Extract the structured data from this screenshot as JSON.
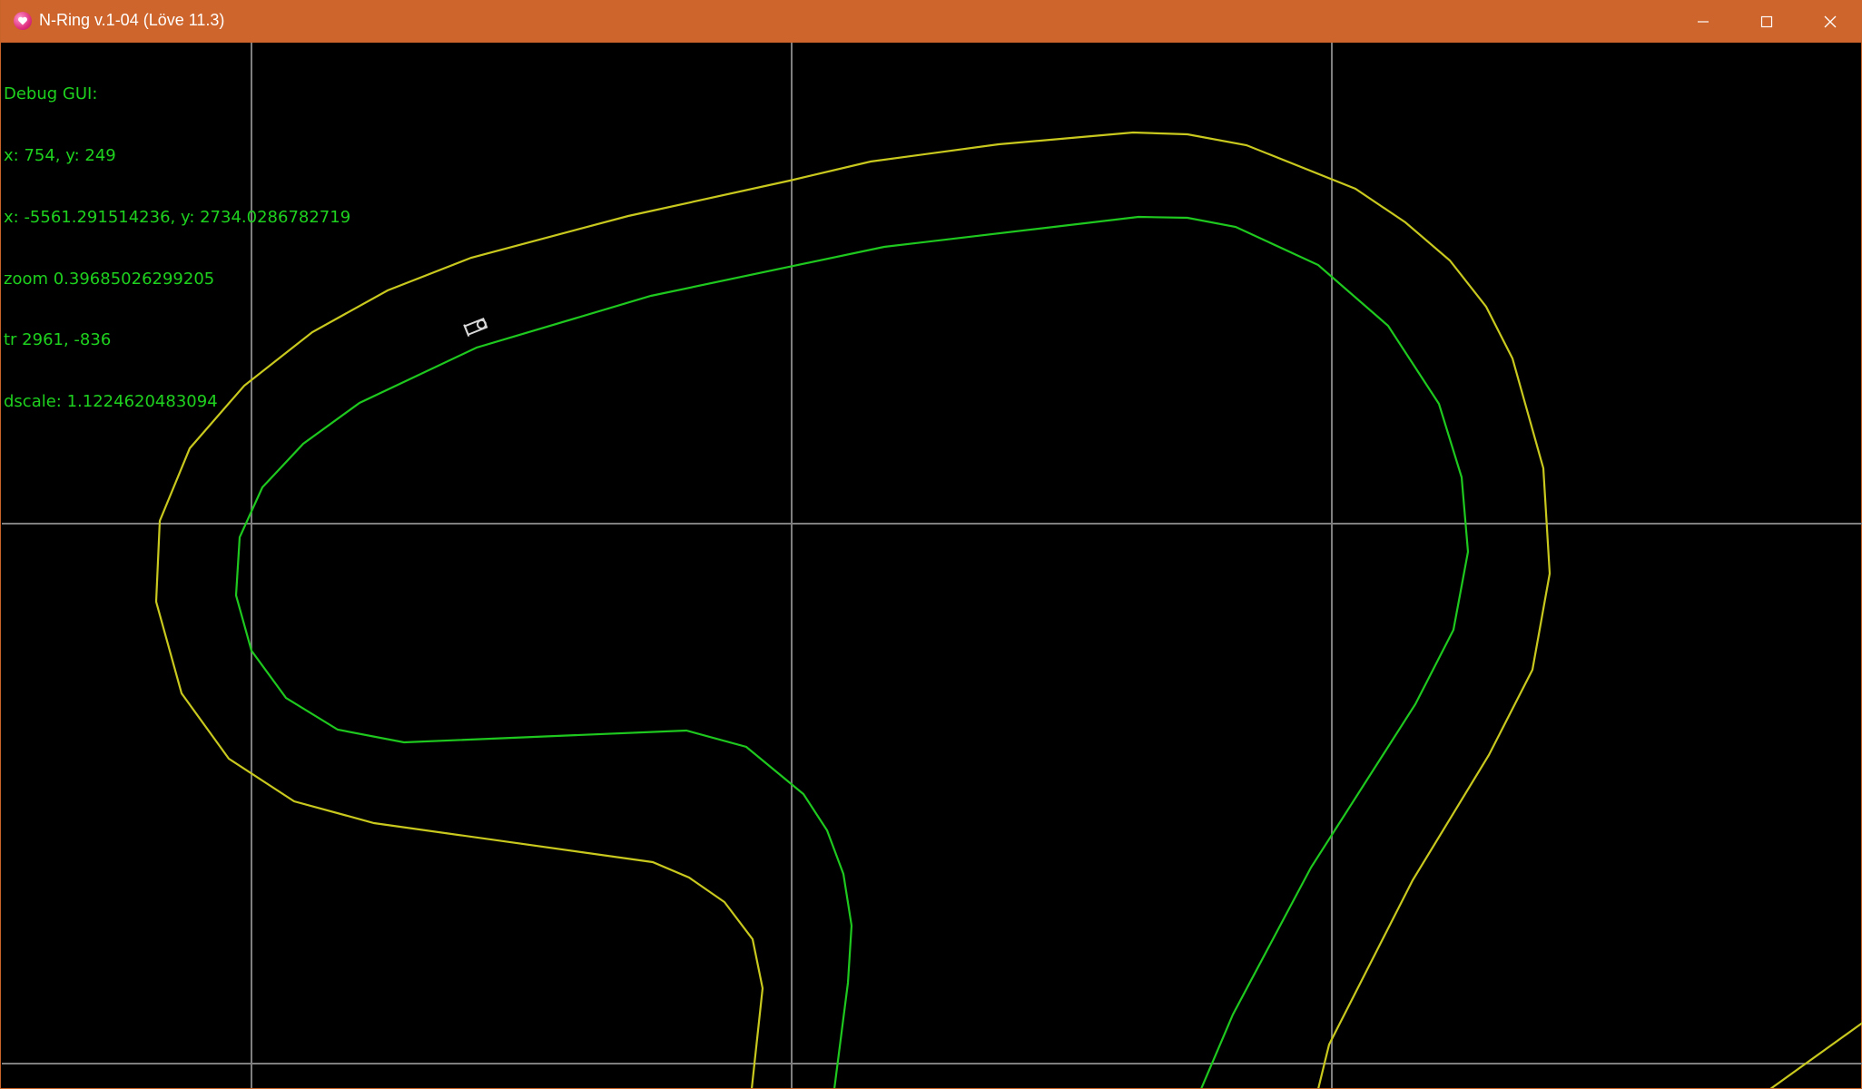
{
  "window": {
    "title": "N-Ring v.1-04 (Löve 11.3)",
    "icon": "love-heart-icon",
    "title_bar_color": "#cd652c",
    "controls": [
      "minimize-icon",
      "maximize-icon",
      "close-icon"
    ]
  },
  "debug": {
    "header": "Debug GUI:",
    "mouse": "x: 754, y: 249",
    "world": "x: -5561.291514236, y: 2734.0286782719",
    "zoom": "zoom 0.39685026299205",
    "translate": "tr 2961, -836",
    "dscale": "dscale: 1.1224620483094",
    "text_color": "#1fd11f"
  },
  "colors": {
    "background": "#000000",
    "grid": "#7f7f7f",
    "outer_track": "#c8c81e",
    "inner_track": "#1ec81e",
    "car": "#d8d8d8"
  }
}
